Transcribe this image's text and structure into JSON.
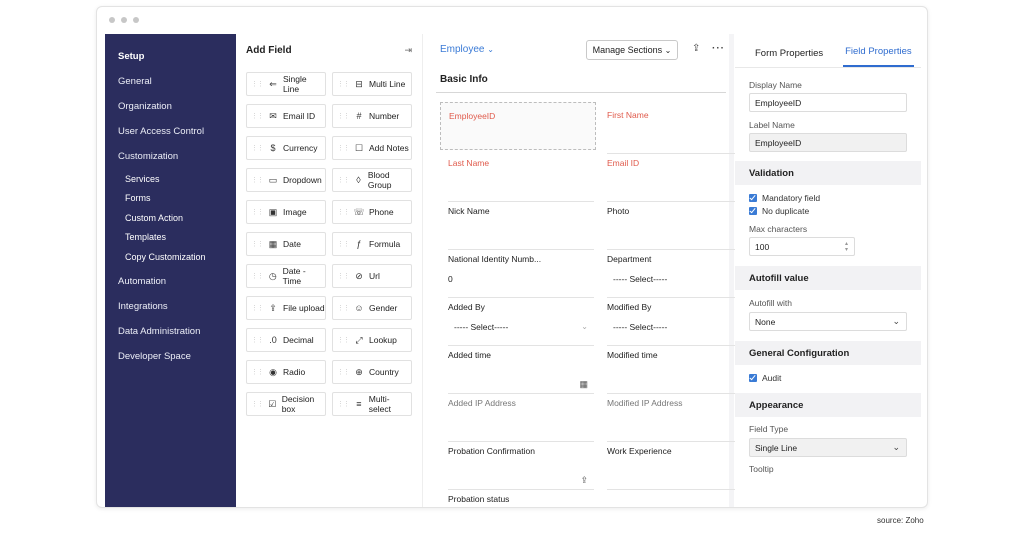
{
  "sidebar": {
    "items": [
      {
        "label": "Setup"
      },
      {
        "label": "General"
      },
      {
        "label": "Organization"
      },
      {
        "label": "User Access Control"
      },
      {
        "label": "Customization"
      }
    ],
    "sub_items": [
      {
        "label": "Services"
      },
      {
        "label": "Forms"
      },
      {
        "label": "Custom Action"
      },
      {
        "label": "Templates"
      },
      {
        "label": "Copy Customization"
      }
    ],
    "items2": [
      {
        "label": "Automation"
      },
      {
        "label": "Integrations"
      },
      {
        "label": "Data Administration"
      },
      {
        "label": "Developer Space"
      }
    ]
  },
  "field_panel": {
    "title": "Add Field",
    "collapse_icon": "collapse-icon",
    "fields": [
      {
        "label": "Single Line",
        "icon": "single-line-icon",
        "glyph": "⇐"
      },
      {
        "label": "Multi Line",
        "icon": "multi-line-icon",
        "glyph": "⊟"
      },
      {
        "label": "Email ID",
        "icon": "email-icon",
        "glyph": "✉"
      },
      {
        "label": "Number",
        "icon": "number-icon",
        "glyph": "#"
      },
      {
        "label": "Currency",
        "icon": "currency-icon",
        "glyph": "$"
      },
      {
        "label": "Add Notes",
        "icon": "notes-icon",
        "glyph": "☐"
      },
      {
        "label": "Dropdown",
        "icon": "dropdown-icon",
        "glyph": "▭"
      },
      {
        "label": "Blood Group",
        "icon": "blood-drop-icon",
        "glyph": "◊"
      },
      {
        "label": "Image",
        "icon": "image-icon",
        "glyph": "▣"
      },
      {
        "label": "Phone",
        "icon": "phone-icon",
        "glyph": "☏"
      },
      {
        "label": "Date",
        "icon": "calendar-icon",
        "glyph": "▦"
      },
      {
        "label": "Formula",
        "icon": "formula-icon",
        "glyph": "ƒ"
      },
      {
        "label": "Date - Time",
        "icon": "date-time-icon",
        "glyph": "◷"
      },
      {
        "label": "Url",
        "icon": "link-icon",
        "glyph": "⊘"
      },
      {
        "label": "File upload",
        "icon": "upload-icon",
        "glyph": "⇪"
      },
      {
        "label": "Gender",
        "icon": "person-icon",
        "glyph": "☺"
      },
      {
        "label": "Decimal",
        "icon": "decimal-icon",
        "glyph": ".0"
      },
      {
        "label": "Lookup",
        "icon": "lookup-icon",
        "glyph": "⤢"
      },
      {
        "label": "Radio",
        "icon": "radio-icon",
        "glyph": "◉"
      },
      {
        "label": "Country",
        "icon": "globe-icon",
        "glyph": "⊕"
      },
      {
        "label": "Decision box",
        "icon": "checkbox-icon",
        "glyph": "☑"
      },
      {
        "label": "Multi-select",
        "icon": "list-icon",
        "glyph": "≡"
      }
    ]
  },
  "canvas": {
    "form_name": "Employee",
    "manage_sections": "Manage Sections",
    "section_title": "Basic Info",
    "fields": {
      "employee_id": "EmployeeID",
      "first_name": "First Name",
      "last_name": "Last Name",
      "email_id": "Email ID",
      "nick_name": "Nick Name",
      "photo": "Photo",
      "national_id": "National Identity Numb...",
      "national_id_value": "0",
      "department": "Department",
      "department_select": "----- Select-----",
      "added_by": "Added By",
      "added_by_select": "----- Select-----",
      "modified_by": "Modified By",
      "modified_by_select": "----- Select-----",
      "added_time": "Added time",
      "modified_time": "Modified time",
      "added_ip": "Added IP Address",
      "modified_ip": "Modified IP Address",
      "probation_confirmation": "Probation Confirmation",
      "work_experience": "Work Experience",
      "probation_status": "Probation status"
    }
  },
  "props": {
    "tabs": [
      "Form Properties",
      "Field Properties"
    ],
    "display_name_label": "Display Name",
    "display_name_value": "EmployeeID",
    "label_name_label": "Label Name",
    "label_name_value": "EmployeeID",
    "validation_title": "Validation",
    "mandatory_label": "Mandatory field",
    "no_duplicate_label": "No duplicate",
    "max_chars_label": "Max characters",
    "max_chars_value": "100",
    "autofill_title": "Autofill value",
    "autofill_with_label": "Autofill with",
    "autofill_with_value": "None",
    "general_config_title": "General Configuration",
    "audit_label": "Audit",
    "appearance_title": "Appearance",
    "field_type_label": "Field Type",
    "field_type_value": "Single Line",
    "tooltip_label": "Tooltip"
  },
  "footer": {
    "source": "source: Zoho"
  }
}
